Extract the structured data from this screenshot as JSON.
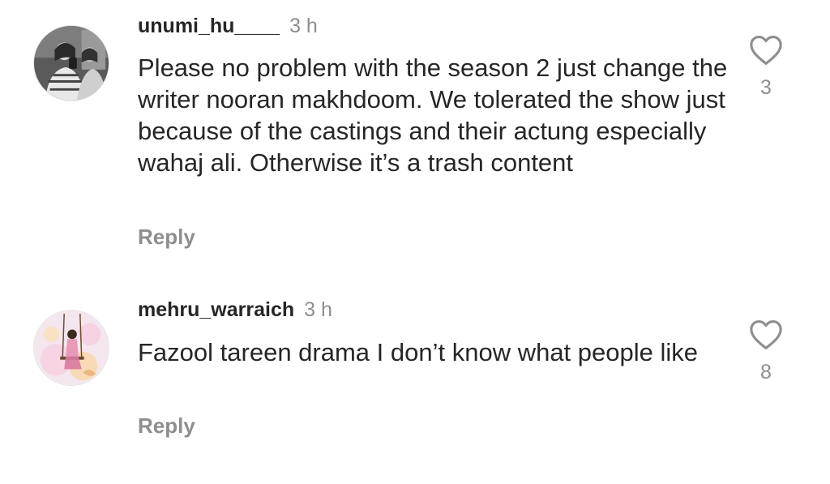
{
  "comments": [
    {
      "username": "unumi_hu____",
      "time": "3 h",
      "text": "Please no problem with the season 2 just change the writer nooran makhdoom. We tolerated the show just because of the castings and their actung especially wahaj ali. Otherwise it’s a trash content",
      "reply_label": "Reply",
      "like_icon": "heart-outline-icon",
      "likes": "3"
    },
    {
      "username": "mehru_warraich",
      "time": "3 h",
      "text": "Fazool tareen drama I don’t know what people like",
      "reply_label": "Reply",
      "like_icon": "heart-outline-icon",
      "likes": "8"
    }
  ],
  "colors": {
    "primary_text": "#262626",
    "secondary_text": "#8e8e8e"
  }
}
